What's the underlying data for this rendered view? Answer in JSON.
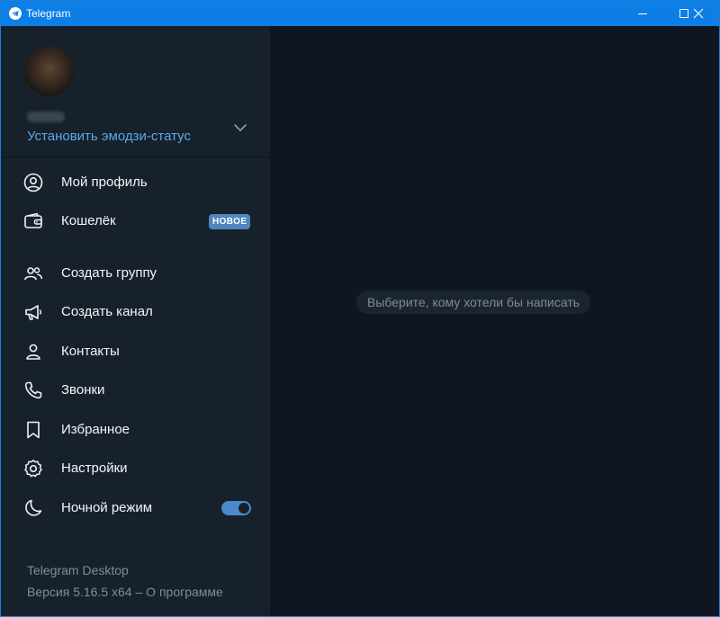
{
  "window": {
    "title": "Telegram"
  },
  "profile": {
    "emoji_status_label": "Установить эмодзи-статус"
  },
  "menu": {
    "items": [
      {
        "label": "Мой профиль",
        "icon": "user-circle-icon"
      },
      {
        "label": "Кошелёк",
        "icon": "wallet-icon",
        "badge": "НОВОЕ"
      },
      {
        "label": "Создать группу",
        "icon": "group-icon"
      },
      {
        "label": "Создать канал",
        "icon": "megaphone-icon"
      },
      {
        "label": "Контакты",
        "icon": "person-icon"
      },
      {
        "label": "Звонки",
        "icon": "phone-icon"
      },
      {
        "label": "Избранное",
        "icon": "bookmark-icon"
      },
      {
        "label": "Настройки",
        "icon": "gear-icon"
      },
      {
        "label": "Ночной режим",
        "icon": "moon-icon",
        "toggle_on": true
      }
    ]
  },
  "footer": {
    "app_name": "Telegram Desktop",
    "version": "Версия 5.16.5 x64",
    "separator": " – ",
    "about": "О программе"
  },
  "main": {
    "placeholder": "Выберите, кому хотели бы написать"
  },
  "colors": {
    "titlebar": "#0d7ee6",
    "sidebar": "#17212b",
    "main": "#0e1621",
    "accent": "#5aa9e8",
    "badge": "#4f86bd"
  }
}
